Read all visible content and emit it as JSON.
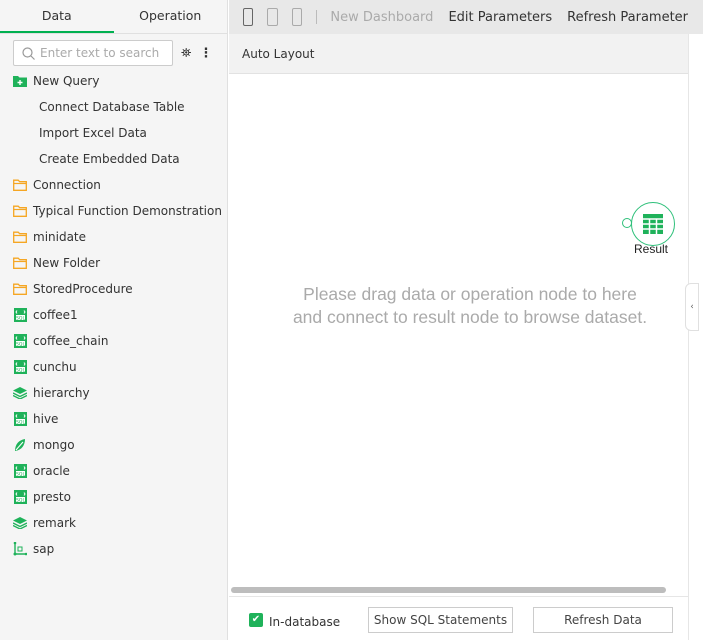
{
  "sidebar": {
    "tabs": [
      {
        "label": "Data",
        "active": true
      },
      {
        "label": "Operation",
        "active": false
      }
    ],
    "search_placeholder": "Enter text to search",
    "items": [
      {
        "label": "New Query",
        "icon": "folder-add-icon",
        "indent": false
      },
      {
        "label": "Connect Database Table",
        "icon": "",
        "indent": true
      },
      {
        "label": "Import Excel Data",
        "icon": "",
        "indent": true
      },
      {
        "label": "Create Embedded Data",
        "icon": "",
        "indent": true
      },
      {
        "label": "Connection",
        "icon": "folder-icon",
        "indent": false
      },
      {
        "label": "Typical Function Demonstration",
        "icon": "folder-icon",
        "indent": false
      },
      {
        "label": "minidate",
        "icon": "folder-icon",
        "indent": false
      },
      {
        "label": "New Folder",
        "icon": "folder-icon",
        "indent": false
      },
      {
        "label": "StoredProcedure",
        "icon": "folder-icon",
        "indent": false
      },
      {
        "label": "coffee1",
        "icon": "sql-icon",
        "indent": false
      },
      {
        "label": "coffee_chain",
        "icon": "sql-icon",
        "indent": false
      },
      {
        "label": "cunchu",
        "icon": "sql-icon",
        "indent": false
      },
      {
        "label": "hierarchy",
        "icon": "layers-icon",
        "indent": false
      },
      {
        "label": "hive",
        "icon": "sql-icon",
        "indent": false
      },
      {
        "label": "mongo",
        "icon": "leaf-icon",
        "indent": false
      },
      {
        "label": "oracle",
        "icon": "sql-icon",
        "indent": false
      },
      {
        "label": "presto",
        "icon": "sql-icon",
        "indent": false
      },
      {
        "label": "remark",
        "icon": "layers-icon",
        "indent": false
      },
      {
        "label": "sap",
        "icon": "cube-axis-icon",
        "indent": false
      }
    ]
  },
  "toolbar": {
    "new_dashboard": "New Dashboard",
    "edit_parameters": "Edit Parameters",
    "refresh_parameter": "Refresh Parameter"
  },
  "layout_label": "Auto Layout",
  "canvas": {
    "hint_line1": "Please drag data or operation node to here",
    "hint_line2": "and connect to result node to browse dataset.",
    "result_node": "Result"
  },
  "bottom": {
    "in_database": "In-database",
    "in_database_checked": true,
    "show_sql": "Show SQL Statements",
    "refresh_data": "Refresh Data"
  },
  "colors": {
    "accent": "#00b050",
    "folder": "#f5a623",
    "icon_green": "#1fb25a"
  }
}
